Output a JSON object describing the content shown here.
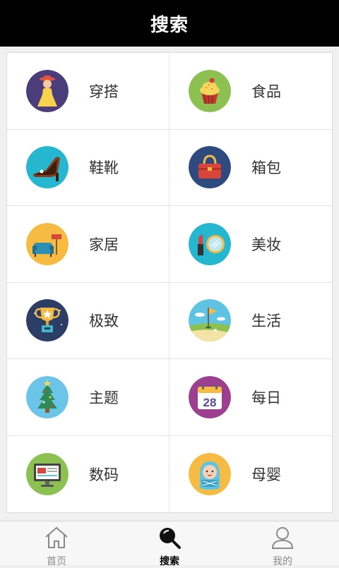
{
  "header": {
    "title": "搜索"
  },
  "categories": [
    {
      "label": "穿搭",
      "icon": "dress-icon",
      "color": "#4a3d7a"
    },
    {
      "label": "食品",
      "icon": "cupcake-icon",
      "color": "#8cc152"
    },
    {
      "label": "鞋靴",
      "icon": "high-heel-icon",
      "color": "#26b7d0"
    },
    {
      "label": "箱包",
      "icon": "handbag-icon",
      "color": "#2f4a7e"
    },
    {
      "label": "家居",
      "icon": "armchair-icon",
      "color": "#f6bb42"
    },
    {
      "label": "美妆",
      "icon": "cosmetics-icon",
      "color": "#26b7d0"
    },
    {
      "label": "极致",
      "icon": "trophy-icon",
      "color": "#2c3e66"
    },
    {
      "label": "生活",
      "icon": "golf-flag-icon",
      "color": "#5fc3e4"
    },
    {
      "label": "主题",
      "icon": "christmas-tree-icon",
      "color": "#6ac5e8"
    },
    {
      "label": "每日",
      "icon": "calendar-icon",
      "color": "#9b3f8e"
    },
    {
      "label": "数码",
      "icon": "monitor-icon",
      "color": "#8cc152"
    },
    {
      "label": "母婴",
      "icon": "baby-icon",
      "color": "#f6bb42"
    }
  ],
  "calendar": {
    "day": "28"
  },
  "tabs": [
    {
      "label": "首页",
      "icon": "home-icon",
      "active": false
    },
    {
      "label": "搜索",
      "icon": "search-icon",
      "active": true
    },
    {
      "label": "我的",
      "icon": "user-icon",
      "active": false
    }
  ]
}
